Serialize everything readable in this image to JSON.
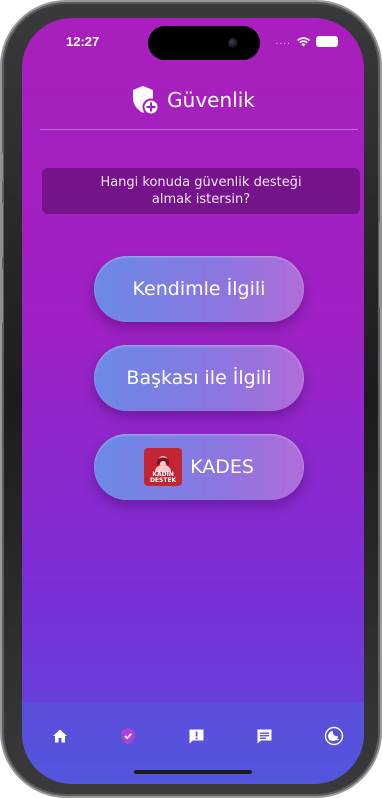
{
  "status_bar": {
    "time": "12:27",
    "signal": "...."
  },
  "header": {
    "title": "Güvenlik",
    "icon": "shield-plus-icon"
  },
  "prompt": {
    "text": "Hangi konuda güvenlik desteği almak istersin?"
  },
  "options": [
    {
      "label": "Kendimle İlgili"
    },
    {
      "label": "Başkası ile İlgili"
    },
    {
      "label": "KADES",
      "logo_text": [
        "KADIN",
        "DESTEK"
      ]
    }
  ],
  "tabbar": {
    "items": [
      {
        "icon": "home-icon",
        "active": false
      },
      {
        "icon": "shield-check-icon",
        "active": true
      },
      {
        "icon": "alert-icon",
        "active": false
      },
      {
        "icon": "message-icon",
        "active": false
      },
      {
        "icon": "moon-icon",
        "active": false
      }
    ]
  },
  "colors": {
    "background_top": "#a91fbd",
    "background_bottom": "#5a49de",
    "active_tab": "#b040d8"
  }
}
